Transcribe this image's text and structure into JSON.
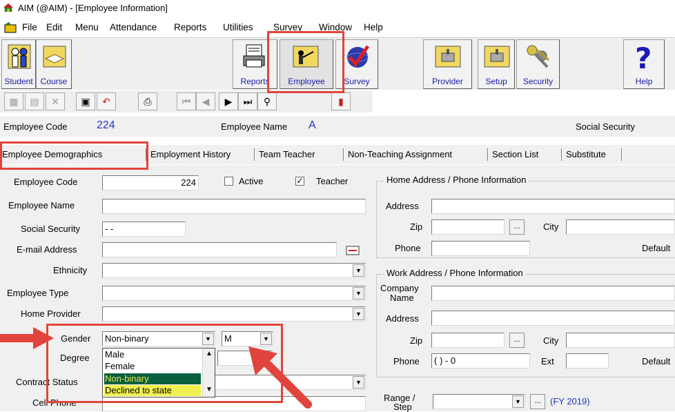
{
  "window": {
    "title": "AIM (@AIM) - [Employee Information]"
  },
  "menu": [
    "File",
    "Edit",
    "Menu",
    "Attendance",
    "Reports",
    "Utilities",
    "Survey",
    "Window",
    "Help"
  ],
  "toolbar": {
    "student": "Student",
    "course": "Course",
    "reports": "Reports",
    "employee": "Employee",
    "survey": "Survey",
    "provider": "Provider",
    "setup": "Setup",
    "security": "Security",
    "help": "Help"
  },
  "header": {
    "code_label": "Employee Code",
    "code_value": "224",
    "name_label": "Employee Name",
    "name_value": "A",
    "ssn_label": "Social Security"
  },
  "tabs": [
    "Employee Demographics",
    "Employment History",
    "Team Teacher",
    "Non-Teaching Assignment",
    "Section List",
    "Substitute"
  ],
  "form": {
    "employee_code_label": "Employee Code",
    "employee_code_value": "224",
    "active_label": "Active",
    "active_checked": false,
    "teacher_label": "Teacher",
    "teacher_checked": true,
    "employee_name_label": "Employee Name",
    "social_security_label": "Social Security",
    "social_security_value": "- -",
    "email_label": "E-mail Address",
    "ethnicity_label": "Ethnicity",
    "employee_type_label": "Employee Type",
    "home_provider_label": "Home Provider",
    "gender_label": "Gender",
    "gender_value": "Non-binary",
    "gender_code": "M",
    "degree_label": "Degree",
    "contract_status_label": "Contract Status",
    "cell_phone_label": "Cell Phone",
    "gender_options": [
      "Male",
      "Female",
      "Non-binary",
      "Declined to state"
    ]
  },
  "home_group": {
    "title": "Home Address / Phone Information",
    "address_label": "Address",
    "zip_label": "Zip",
    "city_label": "City",
    "phone_label": "Phone",
    "default_label": "Default",
    "browse": "..."
  },
  "work_group": {
    "title": "Work Address / Phone Information",
    "company_label_1": "Company",
    "company_label_2": "Name",
    "address_label": "Address",
    "zip_label": "Zip",
    "city_label": "City",
    "phone_label": "Phone",
    "phone_value": "(  )  -  0",
    "ext_label": "Ext",
    "default_label": "Default",
    "browse": "..."
  },
  "range": {
    "label_1": "Range /",
    "label_2": "Step",
    "fy": "(FY 2019)",
    "browse": "..."
  },
  "colors": {
    "accent_blue": "#1f33c9",
    "annotation_red": "#e0443c",
    "selected_bg": "#0a5f3f",
    "highlight_yellow": "#f0f050"
  }
}
